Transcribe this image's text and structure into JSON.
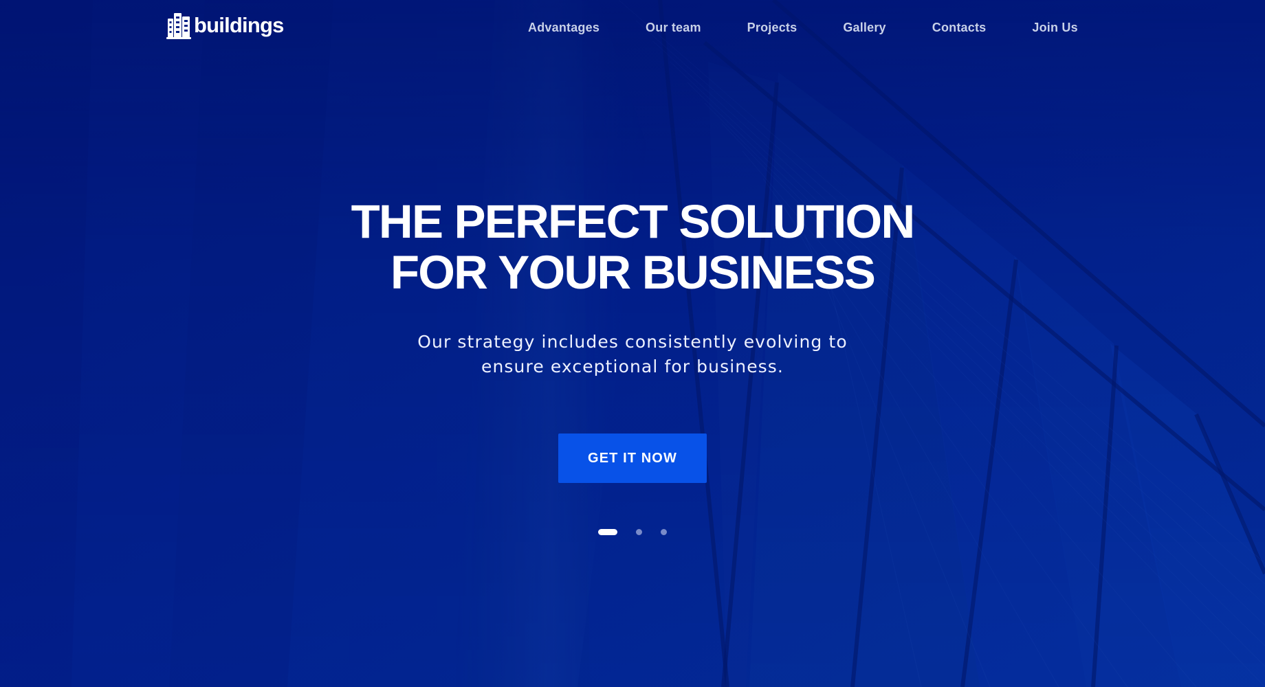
{
  "brand": {
    "name": "buildings",
    "icon": "buildings-logo-icon"
  },
  "navigation": {
    "items": [
      {
        "label": "Advantages"
      },
      {
        "label": "Our team"
      },
      {
        "label": "Projects"
      },
      {
        "label": "Gallery"
      },
      {
        "label": "Contacts"
      },
      {
        "label": "Join Us"
      }
    ]
  },
  "hero": {
    "title": "THE PERFECT SOLUTION FOR YOUR BUSINESS",
    "subtitle": "Our strategy includes consistently evolving to ensure exceptional for business.",
    "cta_label": "GET IT NOW",
    "active_slide": 1,
    "slide_count": 3
  },
  "colors": {
    "background": "#031f85",
    "accent": "#0852e8",
    "nav_text": "#c8d1e8",
    "text": "#ffffff"
  }
}
